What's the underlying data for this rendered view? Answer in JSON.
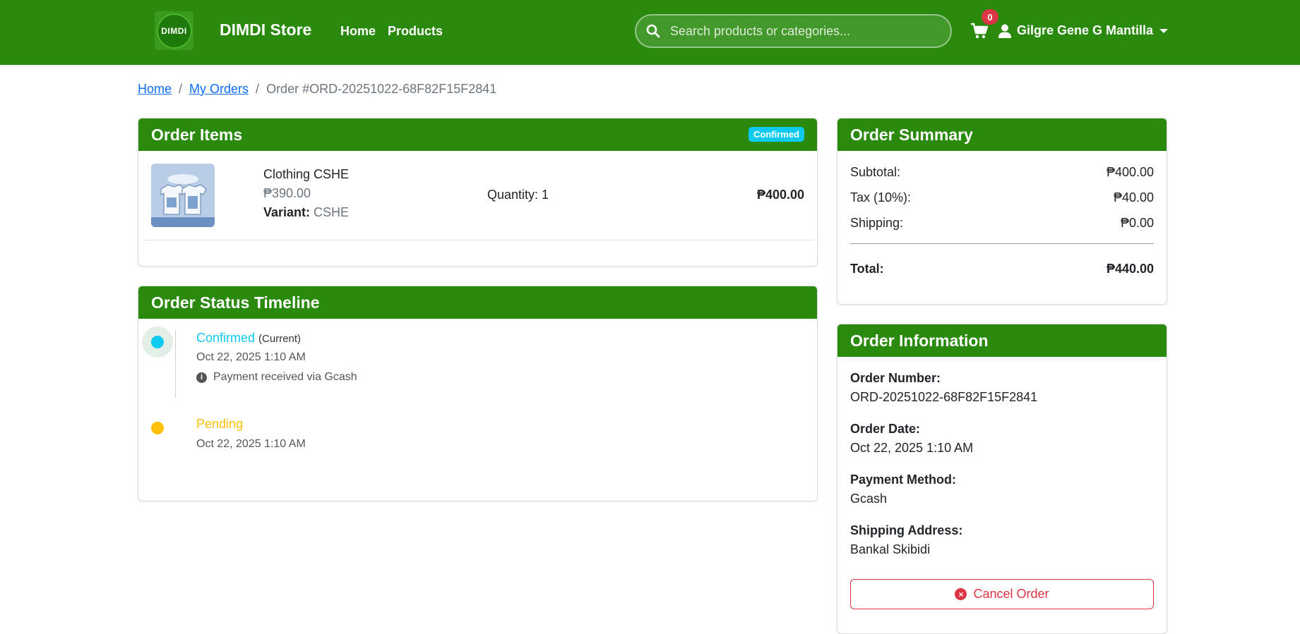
{
  "colors": {
    "brand_green": "#2a8a0e",
    "status_confirmed": "#0dcaf0",
    "status_pending": "#ffc107",
    "danger": "#dc3545"
  },
  "navbar": {
    "logo_text": "DIMDI",
    "brand_name": "DIMDI Store",
    "links": {
      "home": "Home",
      "products": "Products"
    },
    "search_placeholder": "Search products or categories...",
    "cart_count": "0",
    "user_name": "Gilgre Gene G Mantilla"
  },
  "breadcrumb": {
    "home": "Home",
    "my_orders": "My Orders",
    "separator": "/",
    "current": "Order #ORD-20251022-68F82F15F2841"
  },
  "order_items": {
    "title": "Order Items",
    "status": "Confirmed",
    "items": [
      {
        "name": "Clothing CSHE",
        "price": "₱390.00",
        "variant_label": "Variant:",
        "variant_value": "CSHE",
        "quantity": "Quantity: 1",
        "total": "₱400.00"
      }
    ]
  },
  "timeline": {
    "title": "Order Status Timeline",
    "entries": [
      {
        "status": "Confirmed",
        "current_tag": "(Current)",
        "time": "Oct 22, 2025 1:10 AM",
        "note": "Payment received via Gcash"
      },
      {
        "status": "Pending",
        "time": "Oct 22, 2025 1:10 AM"
      }
    ]
  },
  "summary": {
    "title": "Order Summary",
    "subtotal_label": "Subtotal:",
    "subtotal": "₱400.00",
    "tax_label": "Tax (10%):",
    "tax": "₱40.00",
    "shipping_label": "Shipping:",
    "shipping": "₱0.00",
    "total_label": "Total:",
    "total": "₱440.00"
  },
  "info": {
    "title": "Order Information",
    "order_number_label": "Order Number:",
    "order_number": "ORD-20251022-68F82F15F2841",
    "order_date_label": "Order Date:",
    "order_date": "Oct 22, 2025 1:10 AM",
    "payment_label": "Payment Method:",
    "payment": "Gcash",
    "address_label": "Shipping Address:",
    "address": "Bankal Skibidi",
    "cancel_label": "Cancel Order"
  }
}
